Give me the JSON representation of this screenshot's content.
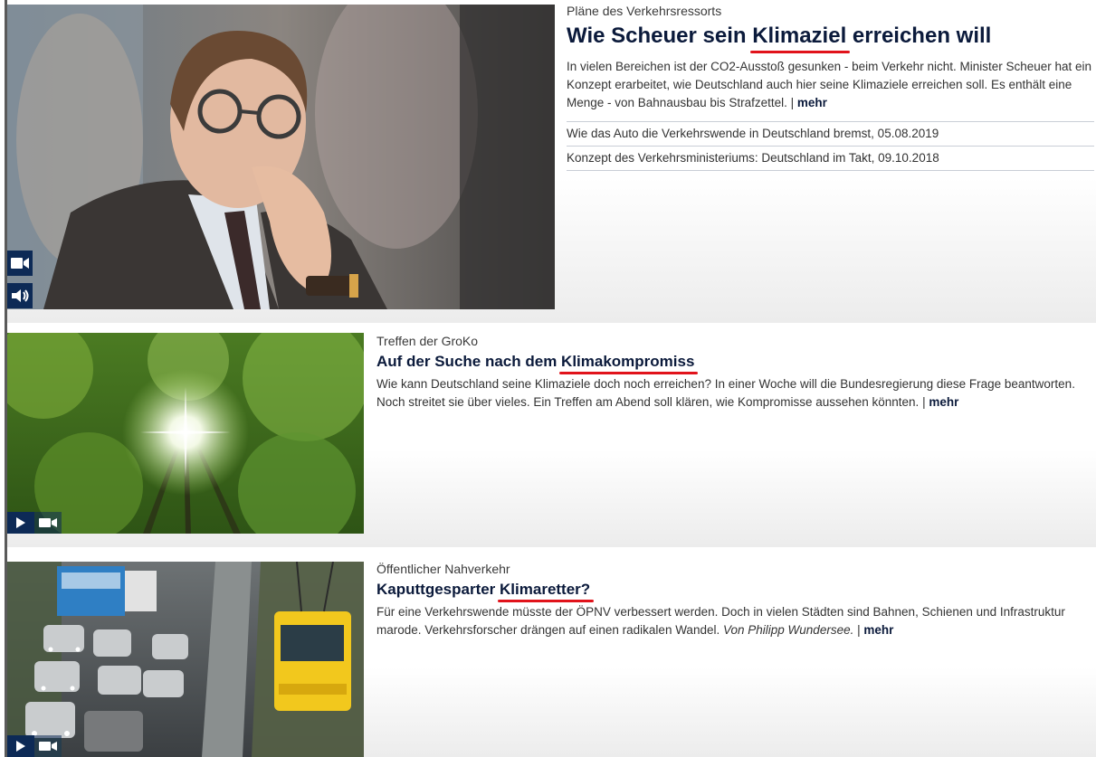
{
  "teasers": [
    {
      "dachzeile": "Pläne des Verkehrsressorts",
      "headline_pre": "Wie Scheuer sein ",
      "headline_hl": "Klimaziel",
      "headline_post": " erreichen will",
      "text": "In vielen Bereichen ist der CO2-Ausstoß gesunken - beim Verkehr nicht. Minister Scheuer hat ein Konzept erarbeitet, wie Deutschland auch hier seine Klimaziele erreichen soll. Es enthält eine Menge - von Bahnausbau bis Strafzettel.",
      "separator": " | ",
      "more": "mehr",
      "related": [
        "Wie das Auto die Verkehrswende in Deutschland bremst, 05.08.2019",
        "Konzept des Verkehrsministeriums: Deutschland im Takt, 09.10.2018"
      ],
      "media_icons": [
        "video-camera-icon",
        "speaker-icon"
      ]
    },
    {
      "dachzeile": "Treffen der GroKo",
      "headline_pre": "Auf der Suche nach dem ",
      "headline_hl": "Klimakompromiss",
      "headline_post": "",
      "text": "Wie kann Deutschland seine Klimaziele doch noch erreichen? In einer Woche will die Bundesregierung diese Frage beantworten. Noch streitet sie über vieles. Ein Treffen am Abend soll klären, wie Kompromisse aussehen könnten.",
      "separator": " | ",
      "more": "mehr",
      "media_icons": [
        "play-icon",
        "video-camera-icon"
      ]
    },
    {
      "dachzeile": "Öffentlicher Nahverkehr",
      "headline_pre": "Kaputtgesparter ",
      "headline_hl": "Klimaretter?",
      "headline_post": "",
      "text": "Für eine Verkehrswende müsste der ÖPNV verbessert werden. Doch in vielen Städten sind Bahnen, Schienen und Infrastruktur marode. Verkehrsforscher drängen auf einen radikalen Wandel.",
      "author": "Von Philipp Wundersee.",
      "separator": " | ",
      "more": "mehr",
      "media_icons": [
        "play-icon",
        "video-camera-icon"
      ]
    }
  ],
  "colors": {
    "headline": "#0b1a3b",
    "highlight_underline": "#e1131b",
    "media_box": "#0d2a56"
  }
}
